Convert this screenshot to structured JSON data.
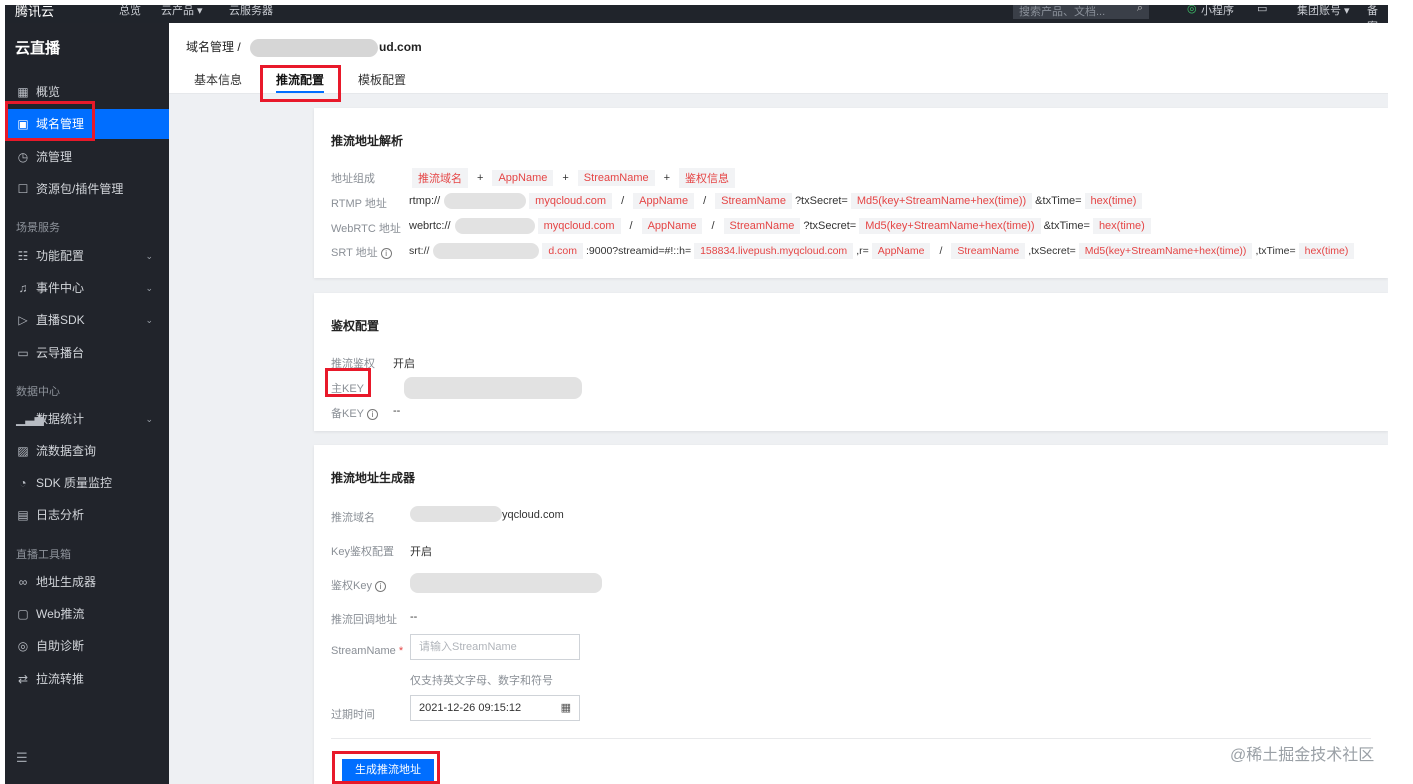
{
  "topbar": {
    "logo": "腾讯云",
    "item1": "总览",
    "item2": "云产品 ▾",
    "item3": "云服务器",
    "search_placeholder": "搜索产品、文档...",
    "mini": "小程序",
    "account": "集团账号 ▾",
    "extra": "备案"
  },
  "sidebar": {
    "product_title": "云直播",
    "items": [
      {
        "label": "概览",
        "icon": "grid-icon"
      },
      {
        "label": "域名管理",
        "icon": "domain-icon"
      },
      {
        "label": "流管理",
        "icon": "stream-icon"
      },
      {
        "label": "资源包/插件管理",
        "icon": "package-icon"
      },
      {
        "label": "功能配置",
        "icon": "settings-sliders-icon"
      },
      {
        "label": "事件中心",
        "icon": "bell-icon"
      },
      {
        "label": "直播SDK",
        "icon": "play-icon"
      },
      {
        "label": "云导播台",
        "icon": "monitor-icon"
      },
      {
        "label": "数据统计",
        "icon": "bar-chart-icon"
      },
      {
        "label": "流数据查询",
        "icon": "query-icon"
      },
      {
        "label": "SDK 质量监控",
        "icon": "gauge-icon"
      },
      {
        "label": "日志分析",
        "icon": "calendar-icon"
      },
      {
        "label": "地址生成器",
        "icon": "link-icon"
      },
      {
        "label": "Web推流",
        "icon": "web-icon"
      },
      {
        "label": "自助诊断",
        "icon": "diagnose-icon"
      },
      {
        "label": "拉流转推",
        "icon": "swap-icon"
      }
    ],
    "sections": [
      "场景服务",
      "数据中心",
      "直播工具箱"
    ]
  },
  "header": {
    "breadcrumb_root": "域名管理",
    "breadcrumb_slash": "/",
    "breadcrumb_domain": "ud.com",
    "tabs": [
      "基本信息",
      "推流配置",
      "模板配置"
    ]
  },
  "parse": {
    "title": "推流地址解析",
    "labels": [
      "地址组成",
      "RTMP 地址",
      "WebRTC 地址",
      "SRT 地址"
    ],
    "compose": [
      "推流域名",
      "+",
      "AppName",
      "+",
      "StreamName",
      "+",
      "鉴权信息"
    ],
    "rtmp": {
      "prefix": "rtmp://",
      "domain": "myqcloud.com",
      "slash": "/",
      "app": "AppName",
      "stream": "StreamName",
      "tx": "?txSecret=",
      "md5": "Md5(key+StreamName+hex(time))",
      "txtime": "&txTime=",
      "hex": "hex(time)"
    },
    "webrtc": {
      "prefix": "webrtc://",
      "domain": "myqcloud.com",
      "slash": "/",
      "app": "AppName",
      "stream": "StreamName",
      "tx": "?txSecret=",
      "md5": "Md5(key+StreamName+hex(time))",
      "txtime": "&txTime=",
      "hex": "hex(time)"
    },
    "srt": {
      "prefix": "srt://",
      "domain": "d.com",
      "port": ":9000?streamid=#!::h=",
      "host": "158834.livepush.myqcloud.com",
      "r": ",r=",
      "app": "AppName",
      "slash": "/",
      "stream": "StreamName",
      "tx": ",txSecret=",
      "md5": "Md5(key+StreamName+hex(time))",
      "txtime": ",txTime=",
      "hex": "hex(time)"
    }
  },
  "auth": {
    "title": "鉴权配置",
    "push_auth_label": "推流鉴权",
    "push_auth_value": "开启",
    "main_key_label": "主KEY",
    "backup_key_label": "备KEY",
    "backup_key_value": "--"
  },
  "generator": {
    "title": "推流地址生成器",
    "domain_label": "推流域名",
    "domain_value": "yqcloud.com",
    "key_auth_label": "Key鉴权配置",
    "key_auth_value": "开启",
    "auth_key_label": "鉴权Key",
    "callback_label": "推流回调地址",
    "callback_value": "--",
    "streamname_label": "StreamName",
    "required_mark": "*",
    "streamname_placeholder": "请输入StreamName",
    "streamname_hint": "仅支持英文字母、数字和符号",
    "expire_label": "过期时间",
    "expire_value": "2021-12-26 09:15:12",
    "generate_button": "生成推流地址"
  },
  "watermark": "@稀土掘金技术社区",
  "colors": {
    "accent": "#006eff",
    "highlight": "#e8192a",
    "sidebar": "#21242b",
    "chip_text": "#e54545"
  }
}
